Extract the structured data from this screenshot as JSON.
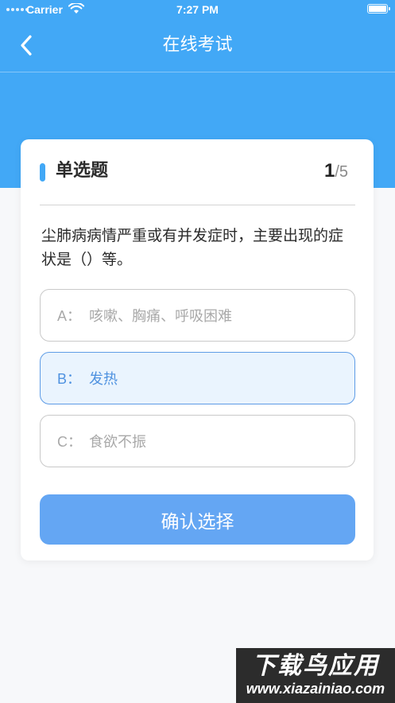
{
  "status_bar": {
    "carrier": "Carrier",
    "time": "7:27 PM",
    "battery_level": 1.0
  },
  "nav": {
    "title": "在线考试",
    "back_icon": "chevron-left-icon"
  },
  "quiz": {
    "section_title": "单选题",
    "current": "1",
    "total": "/5",
    "question": "尘肺病病情严重或有并发症时，主要出现的症状是（）等。",
    "options": [
      {
        "letter": "A：",
        "text": "咳嗽、胸痛、呼吸困难",
        "selected": false
      },
      {
        "letter": "B：",
        "text": "发热",
        "selected": true
      },
      {
        "letter": "C：",
        "text": "食欲不振",
        "selected": false
      }
    ],
    "confirm_label": "确认选择"
  },
  "watermark": {
    "title": "下载鸟应用",
    "url": "www.xiazainiao.com"
  },
  "colors": {
    "primary": "#42a8f6",
    "button": "#64a6f3",
    "selected_border": "#5e9ce6",
    "selected_bg": "#eaf4fe",
    "background": "#f7f8fa"
  }
}
